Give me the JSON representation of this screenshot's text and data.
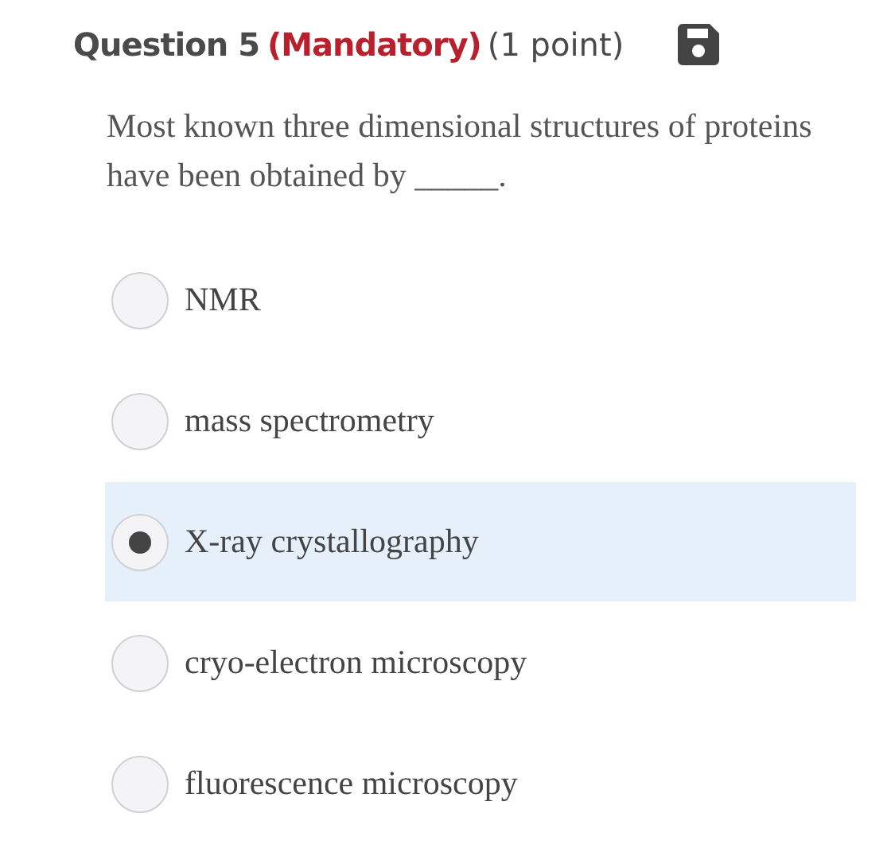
{
  "question": {
    "label": "Question 5",
    "requirement": "(Mandatory)",
    "points": "(1 point)",
    "text": "Most known three dimensional structures of proteins have been obtained by _____."
  },
  "options": [
    {
      "label": "NMR",
      "selected": false
    },
    {
      "label": "mass spectrometry",
      "selected": false
    },
    {
      "label": "X-ray crystallography",
      "selected": true
    },
    {
      "label": "cryo-electron microscopy",
      "selected": false
    },
    {
      "label": "fluorescence microscopy",
      "selected": false
    }
  ]
}
